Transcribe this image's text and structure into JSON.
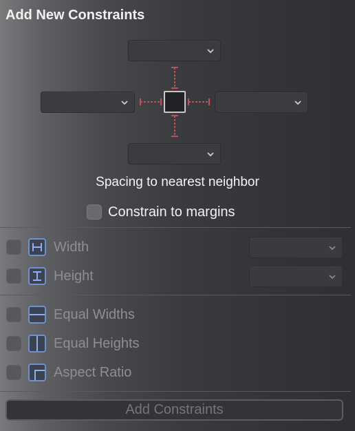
{
  "title": "Add New Constraints",
  "caption": "Spacing to nearest neighbor",
  "constrain_to_margins": "Constrain to margins",
  "rows": {
    "width": "Width",
    "height": "Height",
    "equal_widths": "Equal Widths",
    "equal_heights": "Equal Heights",
    "aspect_ratio": "Aspect Ratio"
  },
  "add_button": "Add Constraints",
  "colors": {
    "strut": "#c0505a",
    "icon_blue": "#6f8fcf"
  }
}
